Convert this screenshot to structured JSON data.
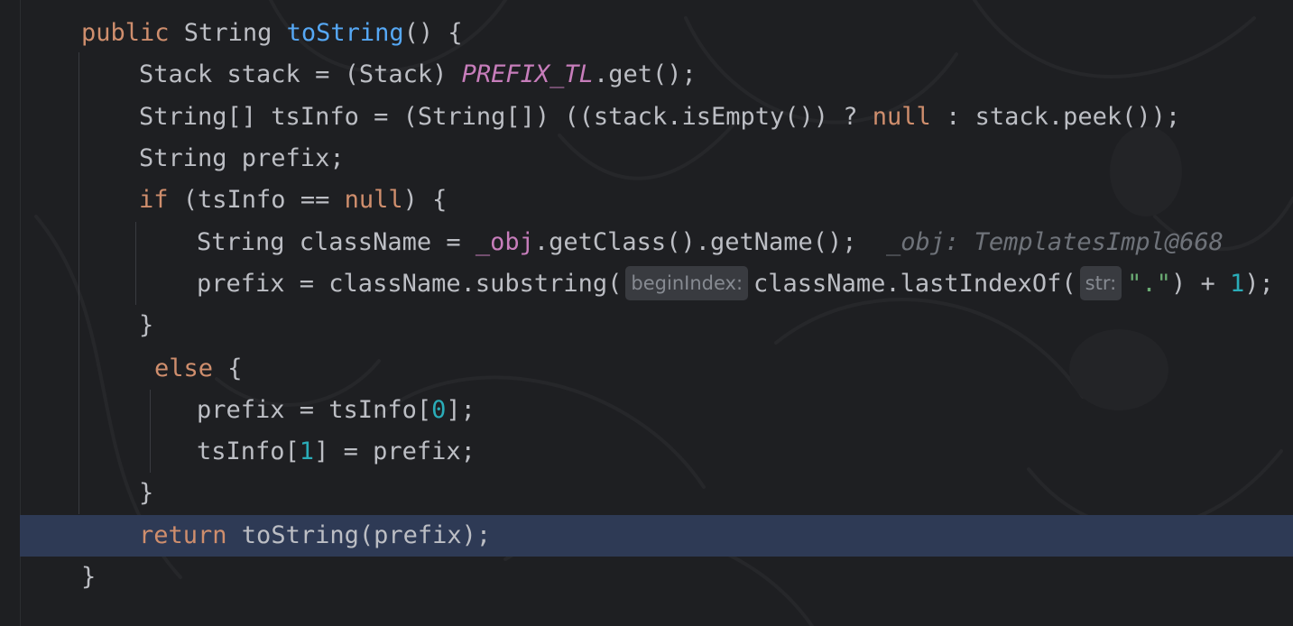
{
  "editor": {
    "current_line_color": "#2e3a55",
    "background": "#1e1f22",
    "lines": [
      {
        "kw1": "public",
        "t1": " String ",
        "fn": "toString",
        "t2": "() {"
      },
      {
        "t1": "Stack stack = (Stack) ",
        "st": "PREFIX_TL",
        "t2": ".get();"
      },
      {
        "t1": "String[] tsInfo = (String[]) ((stack.isEmpty()) ? ",
        "kw1": "null",
        "t2": " : stack.peek());"
      },
      {
        "t1": "String prefix;"
      },
      {
        "kw1": "if",
        "t1": " (tsInfo == ",
        "kw2": "null",
        "t2": ") {"
      },
      {
        "t1": "String className = ",
        "obj": "_obj",
        "t2": ".getClass().getName();",
        "hint": "_obj: TemplatesImpl@668"
      },
      {
        "t1": "prefix = className.substring(",
        "hint1": "beginIndex:",
        "t2": "className.lastIndexOf(",
        "hint2": "str:",
        "str": "\".\"",
        "t3": ") + ",
        "num": "1",
        "t4": ");"
      },
      {
        "t1": "}"
      },
      {
        "kw1": "else",
        "t1": " {"
      },
      {
        "t1": "prefix = tsInfo[",
        "num": "0",
        "t2": "];"
      },
      {
        "t1": "tsInfo[",
        "num": "1",
        "t2": "] = prefix;"
      },
      {
        "t1": "}"
      },
      {
        "kw1": "return",
        "t1": " toString(prefix);"
      },
      {
        "t1": "}"
      }
    ]
  }
}
